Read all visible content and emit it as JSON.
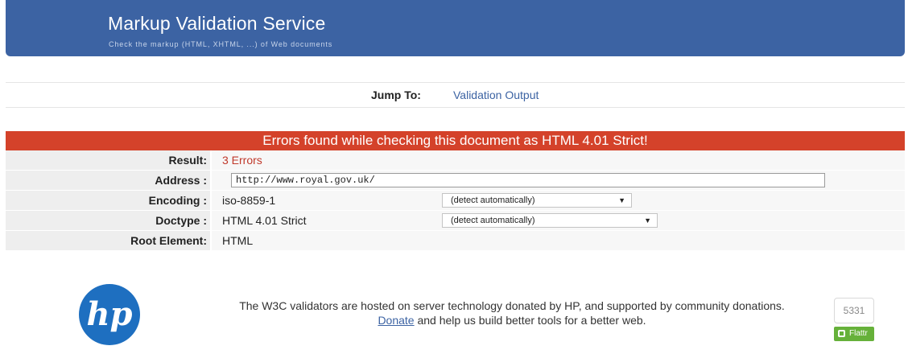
{
  "banner": {
    "title": "Markup Validation Service",
    "subtitle": "Check the markup (HTML, XHTML, ...) of Web documents"
  },
  "jump": {
    "label": "Jump To:",
    "link": "Validation Output"
  },
  "results_header": "Errors found while checking this document as HTML 4.01 Strict!",
  "rows": {
    "result": {
      "label": "Result:",
      "value": "3 Errors"
    },
    "address": {
      "label": "Address :",
      "value": "http://www.royal.gov.uk/"
    },
    "encoding": {
      "label": "Encoding :",
      "value": "iso-8859-1",
      "select": "(detect automatically)"
    },
    "doctype": {
      "label": "Doctype :",
      "value": "HTML 4.01 Strict",
      "select": "(detect automatically)"
    },
    "root": {
      "label": "Root Element:",
      "value": "HTML"
    }
  },
  "footer": {
    "text_line1": "The W3C validators are hosted on server technology donated by HP, and supported by community donations.",
    "donate_link": "Donate",
    "text_line2_rest": " and help us build better tools for a better web.",
    "logo_text": "hp",
    "counter": "5331",
    "flattr_label": "Flattr"
  },
  "colors": {
    "banner": "#3c63a3",
    "error_header": "#d4422a",
    "link": "#3c63a3",
    "flattr": "#66b13a"
  }
}
